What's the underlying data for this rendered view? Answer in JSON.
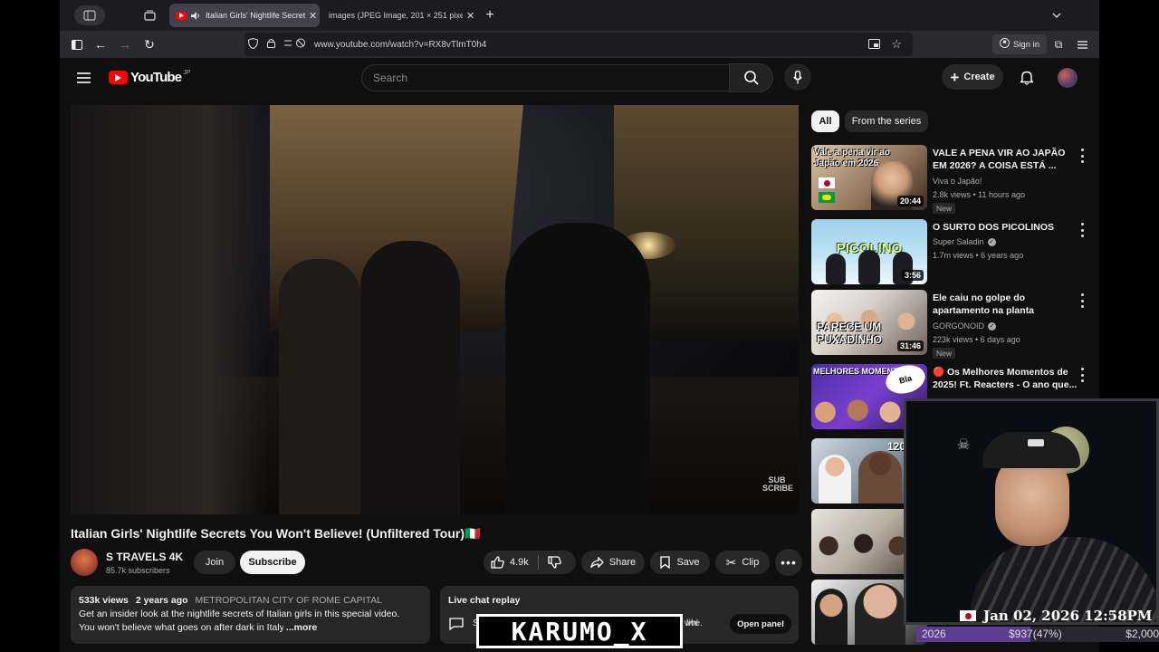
{
  "browser": {
    "tabs": [
      {
        "label": "Italian Girls' Nightlife Secrets You Won't Believe!",
        "active": true,
        "icon": "youtube-favicon"
      },
      {
        "label": "images (JPEG Image, 201 × 251 pixels)",
        "active": false,
        "icon": "image-favicon"
      }
    ],
    "url": "www.youtube.com/watch?v=RX8vTlmT0h4",
    "sign_in": "Sign in"
  },
  "youtube": {
    "logo": "YouTube",
    "region": "JP",
    "search_placeholder": "Search",
    "create": "Create",
    "video": {
      "title": "Italian Girls' Nightlife Secrets You Won't Believe! (Unfiltered Tour)🇮🇹",
      "overlay_badge": "SUB SCRIBE",
      "channel": "S TRAVELS 4K",
      "subscribers": "85.7k subscribers",
      "join": "Join",
      "subscribe": "Subscribe",
      "likes": "4.9k",
      "share": "Share",
      "save": "Save",
      "clip": "Clip"
    },
    "description": {
      "views": "533k views",
      "age": "2 years ago",
      "location": "METROPOLITAN CITY OF ROME CAPITAL",
      "line1": "Get an insider look at the nightlife secrets of Italian girls in this special video.",
      "line2": "You won't believe what goes on after dark in Italy!",
      "more": "...more"
    },
    "live_chat": {
      "title": "Live chat replay",
      "text_start": "S",
      "text_end": "whi",
      "text_tail": "live.",
      "open_panel": "Open panel"
    },
    "chips": [
      "All",
      "From the series"
    ],
    "recommendations": [
      {
        "thumb_text": "Vale a pena vir ao Japão em 2026",
        "duration": "20:44",
        "title": "VALE A PENA VIR AO JAPÃO EM 2026? A COISA ESTÁ ...",
        "channel": "Viva o Japão!",
        "verified": false,
        "meta": "2.8k views • 11 hours ago",
        "badge": "New"
      },
      {
        "thumb_text": "PICOLINO",
        "duration": "3:56",
        "title": "O SURTO DOS PICOLINOS",
        "channel": "Super Saladin",
        "verified": true,
        "meta": "1.7m views • 6 years ago",
        "badge": ""
      },
      {
        "thumb_text": "PARECE UM PUXADINHO",
        "duration": "31:46",
        "title": "Ele caiu no golpe do apartamento na planta",
        "channel": "GORGONOID",
        "verified": true,
        "meta": "223k views • 6 days ago",
        "badge": "New"
      },
      {
        "thumb_text": "MELHORES MOMENTOS",
        "duration": "",
        "title": "🔴 Os Melhores Momentos de 2025! Ft. Reacters - O ano que...",
        "channel": "",
        "verified": false,
        "meta": "",
        "badge": ""
      },
      {
        "thumb_text": "120",
        "duration": "",
        "title": "",
        "channel": "",
        "verified": false,
        "meta": "",
        "badge": ""
      },
      {
        "thumb_text": "",
        "duration": "",
        "title": "",
        "channel": "",
        "verified": false,
        "meta": "",
        "badge": ""
      },
      {
        "thumb_text": "",
        "duration": "",
        "title": "",
        "channel": "",
        "verified": false,
        "meta": "",
        "badge": ""
      }
    ]
  },
  "overlay": {
    "stream_date": "Jan 02, 2026 12:58PM",
    "goal_year": "2026",
    "goal_current": "$937(47%)",
    "goal_target": "$2,000",
    "goal_progress": 0.47,
    "watermark": "KARUMO_X"
  },
  "colors": {
    "youtube_red": "#ff0000",
    "background": "#0f0f0f",
    "chip_bg": "#272727",
    "text_secondary": "#aaaaaa",
    "goal_fill": "#5b3e8f"
  }
}
